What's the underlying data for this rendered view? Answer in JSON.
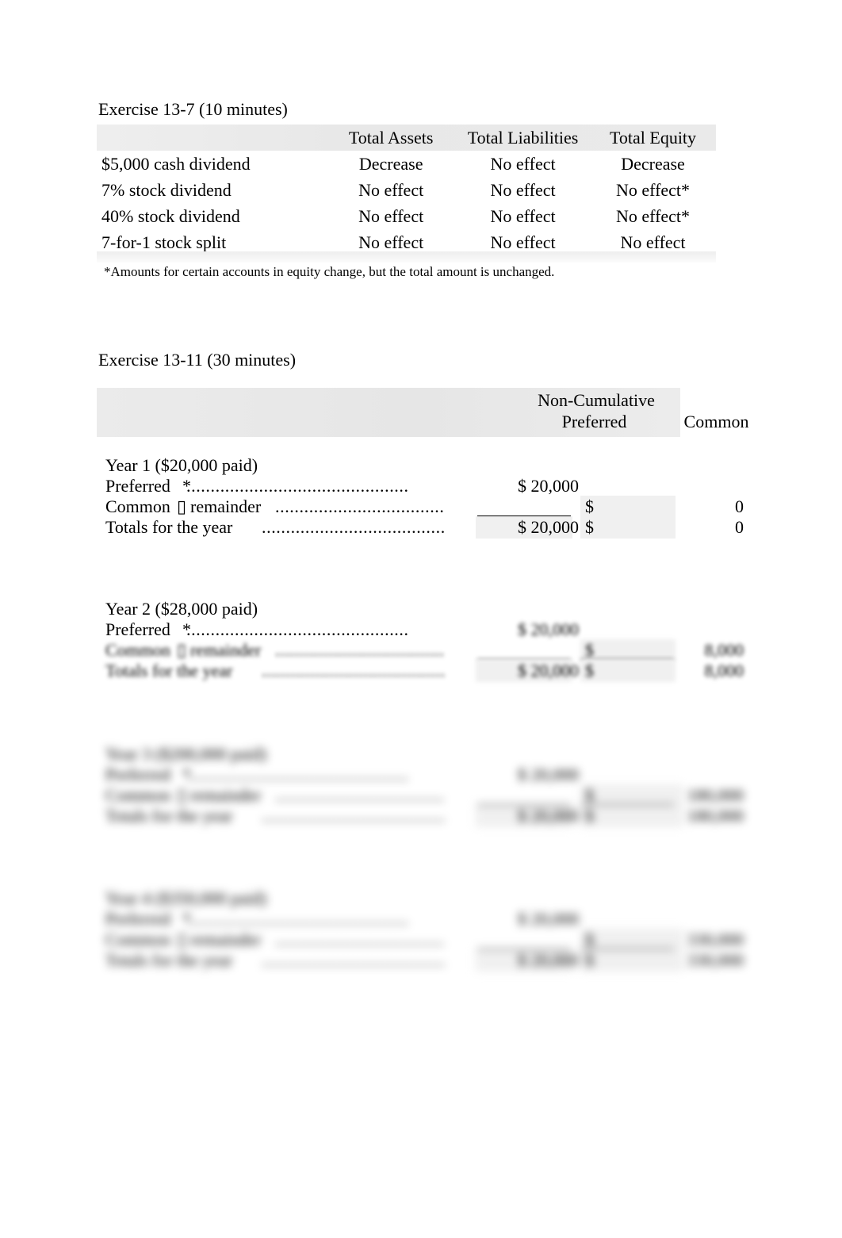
{
  "document": {
    "background_color": "#ffffff",
    "text_color": "#000000"
  },
  "exercise_13_7": {
    "title": "Exercise 13-7 (10 minutes)",
    "footnote": "*Amounts for certain accounts in equity change, but the total amount is unchanged.",
    "header_shade_color": "#e9e9e9",
    "columns": [
      "",
      "Total Assets",
      "Total Liabilities",
      "Total Equity"
    ],
    "rows": [
      {
        "label": "$5,000 cash dividend",
        "total_assets": "Decrease",
        "total_liabilities": "No effect",
        "total_equity": "Decrease"
      },
      {
        "label": "7% stock dividend",
        "total_assets": "No effect",
        "total_liabilities": "No effect",
        "total_equity": "No effect*"
      },
      {
        "label": "40% stock dividend",
        "total_assets": "No effect",
        "total_liabilities": "No effect",
        "total_equity": "No effect*"
      },
      {
        "label": "7-for-1 stock split",
        "total_assets": "No effect",
        "total_liabilities": "No effect",
        "total_equity": "No effect"
      }
    ]
  },
  "exercise_13_11": {
    "title": "Exercise 13-11 (30 minutes)",
    "header_shade_color": "#e9e9e9",
    "header": {
      "group_label": "Non-Cumulative",
      "col_preferred": "Preferred",
      "col_common": "Common"
    },
    "blocks": [
      {
        "heading": "Year 1 ($20,000 paid)",
        "blur": "none",
        "rows": [
          {
            "label": "Preferred",
            "marker": "*",
            "dots": "..............................................",
            "preferred": "$ 20,000",
            "common_sign": "",
            "common_value": ""
          },
          {
            "label": "Common",
            "marker": "▯",
            "suffix": "remainder",
            "dots": "...................................",
            "preferred": "",
            "common_sign": "$",
            "common_value": "0"
          },
          {
            "label": "Totals for the year",
            "marker": "",
            "dots": ".........................................",
            "preferred": "$ 20,000",
            "common_sign": "$",
            "common_value": "0"
          }
        ]
      },
      {
        "heading": "Year 2 ($28,000 paid)",
        "blur": "light",
        "rows": [
          {
            "label": "Preferred",
            "marker": "*",
            "dots": "..............................................",
            "preferred": "$ 20,000",
            "common_sign": "",
            "common_value": ""
          },
          {
            "label": "Common",
            "marker": "▯",
            "suffix": "remainder",
            "dots": "...................................",
            "preferred": "",
            "common_sign": "$",
            "common_value": "8,000"
          },
          {
            "label": "Totals for the year",
            "marker": "",
            "dots": ".........................................",
            "preferred": "$ 20,000",
            "common_sign": "$",
            "common_value": "8,000"
          }
        ]
      },
      {
        "heading": "Year 3 ($200,000 paid)",
        "blur": "heavy",
        "rows": [
          {
            "label": "Preferred",
            "marker": "*",
            "dots": "..............................................",
            "preferred": "$ 20,000",
            "common_sign": "",
            "common_value": ""
          },
          {
            "label": "Common",
            "marker": "▯",
            "suffix": "remainder",
            "dots": "...................................",
            "preferred": "",
            "common_sign": "$",
            "common_value": "180,000"
          },
          {
            "label": "Totals for the year",
            "marker": "",
            "dots": ".........................................",
            "preferred": "$ 20,000",
            "common_sign": "$",
            "common_value": "180,000"
          }
        ]
      },
      {
        "heading": "Year 4 ($350,000 paid)",
        "blur": "heavy",
        "rows": [
          {
            "label": "Preferred",
            "marker": "*",
            "dots": "..............................................",
            "preferred": "$ 20,000",
            "common_sign": "",
            "common_value": ""
          },
          {
            "label": "Common",
            "marker": "▯",
            "suffix": "remainder",
            "dots": "...................................",
            "preferred": "",
            "common_sign": "$",
            "common_value": "330,000"
          },
          {
            "label": "Totals for the year",
            "marker": "",
            "dots": ".........................................",
            "preferred": "$ 20,000",
            "common_sign": "$",
            "common_value": "330,000"
          }
        ]
      }
    ]
  }
}
